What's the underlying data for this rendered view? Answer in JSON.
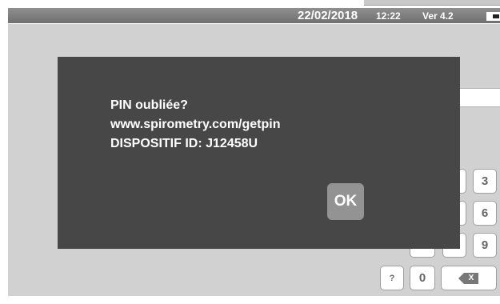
{
  "status_bar": {
    "date": "22/02/2018",
    "time": "12:22",
    "version": "Ver 4.2",
    "battery_icon": "battery-icon"
  },
  "keypad": {
    "keys": [
      "3",
      "6",
      "9",
      "?",
      "0"
    ],
    "backspace_icon": "backspace-icon"
  },
  "dialog": {
    "line1": "PIN oubliée?",
    "line2": "www.spirometry.com/getpin",
    "line3": "DISPOSITIF ID: J12458U",
    "ok_label": "OK"
  },
  "colors": {
    "status_bar": "#7f7f7f",
    "screen_background": "#d1d1d1",
    "dialog_background": "#474747",
    "ok_button": "#939393"
  }
}
